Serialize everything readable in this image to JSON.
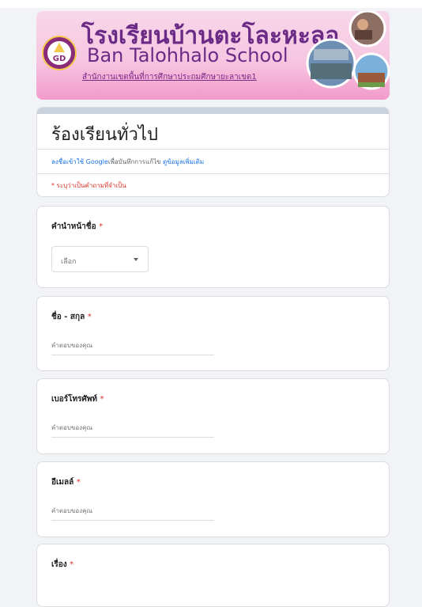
{
  "header": {
    "school_name_th": "โรงเรียนบ้านตะโละหะลอ",
    "school_name_en": "Ban Talohhalo School",
    "subtitle": "สำนักงานเขตพื้นที่การศึกษาประถมศึกษายะลาเขต1",
    "logo_text": "GD"
  },
  "form": {
    "title": "ร้องเรียนทั่วไป",
    "signin_prefix": "ลงชื่อเข้าใช้ Google",
    "signin_middle": "เพื่อบันทึกการแก้ไข ",
    "signin_link": "ดูข้อมูลเพิ่มเติม",
    "required_note": "* ระบุว่าเป็นคำถามที่จำเป็น"
  },
  "questions": [
    {
      "label": "คำนำหน้าชื่อ",
      "star": "*",
      "type": "select",
      "value": "เลือก"
    },
    {
      "label": "ชื่อ - สกุล",
      "star": "*",
      "type": "text",
      "placeholder": "คำตอบของคุณ"
    },
    {
      "label": "เบอร์โทรศัพท์",
      "star": "*",
      "type": "text",
      "placeholder": "คำตอบของคุณ"
    },
    {
      "label": "อีเมลล์",
      "star": "*",
      "type": "text",
      "placeholder": "คำตอบของคุณ"
    },
    {
      "label": "เรื่อง",
      "star": "*",
      "type": "text"
    }
  ],
  "colors": {
    "accent": "#673ab7",
    "required": "#d93025",
    "link": "#1a73e8",
    "banner_pink": "#f6c7e1",
    "banner_text": "#6a2a86"
  }
}
